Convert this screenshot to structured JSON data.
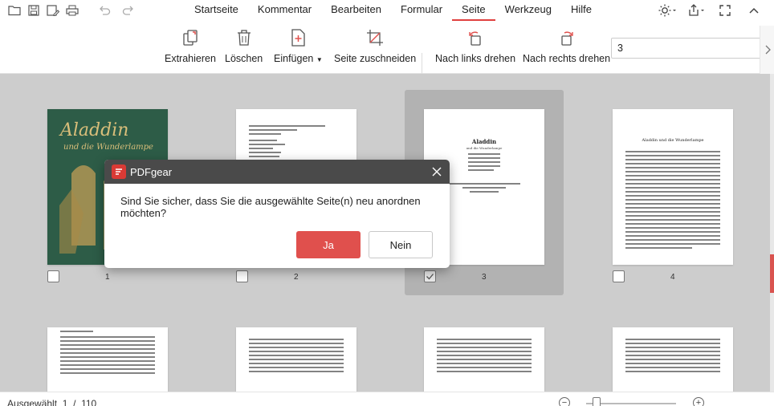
{
  "app": {
    "name": "PDFgear"
  },
  "menu": {
    "items": [
      "Startseite",
      "Kommentar",
      "Bearbeiten",
      "Formular",
      "Seite",
      "Werkzeug",
      "Hilfe"
    ],
    "active": "Seite"
  },
  "toolbar": {
    "extract": "Extrahieren",
    "delete": "Löschen",
    "insert": "Einfügen",
    "crop": "Seite zuschneiden",
    "rotate_left": "Nach links drehen",
    "rotate_right": "Nach rechts drehen",
    "page_value": "3"
  },
  "pages": [
    {
      "number": "1",
      "checked": false,
      "cover_title": "Aladdin",
      "cover_sub": "und die Wunderlampe"
    },
    {
      "number": "2",
      "checked": false
    },
    {
      "number": "3",
      "checked": true,
      "title": "Aladdin",
      "sub": "und die Wunderlampe"
    },
    {
      "number": "4",
      "checked": false,
      "heading": "Aladdin und die Wunderlampe"
    }
  ],
  "dialog": {
    "title": "PDFgear",
    "message": "Sind Sie sicher, dass Sie die ausgewählte Seite(n) neu anordnen möchten?",
    "yes": "Ja",
    "no": "Nein"
  },
  "status": {
    "selected_label": "Ausgewählt",
    "selected": "1",
    "separator": "/",
    "total": "110"
  },
  "colors": {
    "accent": "#e0504d",
    "dialog_header": "#4a4a4a",
    "cover": "#2a5a45"
  }
}
